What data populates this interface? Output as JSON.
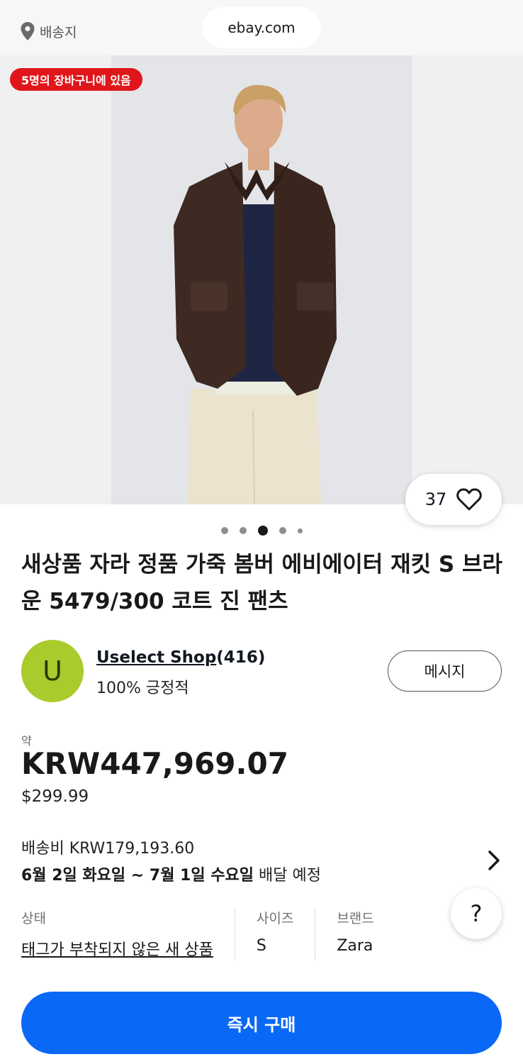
{
  "header": {
    "location_label": "배송지",
    "url": "ebay.com"
  },
  "gallery": {
    "cart_badge": "5명의 장바구니에 있음",
    "watch_count": "37",
    "image_count": 5,
    "active_image_index": 2
  },
  "product": {
    "title": "새상품 자라 정품 가죽 봄버 에비에이터 재킷 S 브라운 5479/300 코트 진 팬츠"
  },
  "seller": {
    "avatar_letter": "U",
    "name": "Uselect Shop",
    "feedback_count": "(416)",
    "positive": "100% 긍정적",
    "message_button": "메시지"
  },
  "price": {
    "approx_label": "약",
    "krw": "KRW447,969.07",
    "usd": "$299.99"
  },
  "shipping": {
    "cost": "배송비 KRW179,193.60",
    "start_date": "6월 2일 화요일",
    "separator": " ~ ",
    "end_date": "7월 1일 수요일",
    "suffix": " 배달 예정"
  },
  "specs": [
    {
      "label": "상태",
      "value": "태그가 부착되지 않은 새 상품"
    },
    {
      "label": "사이즈",
      "value": "S"
    },
    {
      "label": "브랜드",
      "value": "Zara"
    }
  ],
  "help_label": "?",
  "buy_button": "즉시 구매",
  "colors": {
    "accent_blue": "#0968f6",
    "badge_red": "#e0161b",
    "avatar_green": "#a9cb2c"
  }
}
